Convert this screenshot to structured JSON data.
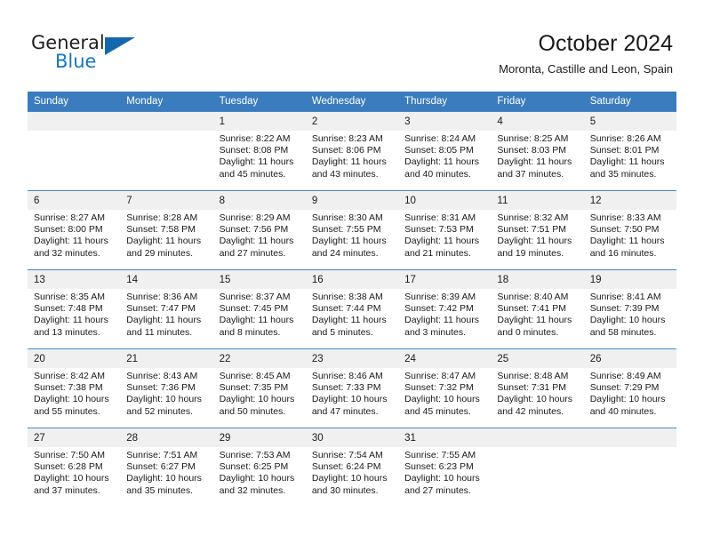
{
  "logo": {
    "word1": "General",
    "word2": "Blue",
    "triangle_color": "#1567ad",
    "blue_color": "#1479bb"
  },
  "header": {
    "title": "October 2024",
    "subtitle": "Moronta, Castille and Leon, Spain"
  },
  "theme": {
    "header_blue": "#3a7cbd",
    "grid_line": "#4a86c5",
    "daynum_bg": "#f0f0f0"
  },
  "weekdays": [
    "Sunday",
    "Monday",
    "Tuesday",
    "Wednesday",
    "Thursday",
    "Friday",
    "Saturday"
  ],
  "weeks": [
    [
      {
        "day": "",
        "lines": []
      },
      {
        "day": "",
        "lines": []
      },
      {
        "day": "1",
        "lines": [
          "Sunrise: 8:22 AM",
          "Sunset: 8:08 PM",
          "Daylight: 11 hours",
          "and 45 minutes."
        ]
      },
      {
        "day": "2",
        "lines": [
          "Sunrise: 8:23 AM",
          "Sunset: 8:06 PM",
          "Daylight: 11 hours",
          "and 43 minutes."
        ]
      },
      {
        "day": "3",
        "lines": [
          "Sunrise: 8:24 AM",
          "Sunset: 8:05 PM",
          "Daylight: 11 hours",
          "and 40 minutes."
        ]
      },
      {
        "day": "4",
        "lines": [
          "Sunrise: 8:25 AM",
          "Sunset: 8:03 PM",
          "Daylight: 11 hours",
          "and 37 minutes."
        ]
      },
      {
        "day": "5",
        "lines": [
          "Sunrise: 8:26 AM",
          "Sunset: 8:01 PM",
          "Daylight: 11 hours",
          "and 35 minutes."
        ]
      }
    ],
    [
      {
        "day": "6",
        "lines": [
          "Sunrise: 8:27 AM",
          "Sunset: 8:00 PM",
          "Daylight: 11 hours",
          "and 32 minutes."
        ]
      },
      {
        "day": "7",
        "lines": [
          "Sunrise: 8:28 AM",
          "Sunset: 7:58 PM",
          "Daylight: 11 hours",
          "and 29 minutes."
        ]
      },
      {
        "day": "8",
        "lines": [
          "Sunrise: 8:29 AM",
          "Sunset: 7:56 PM",
          "Daylight: 11 hours",
          "and 27 minutes."
        ]
      },
      {
        "day": "9",
        "lines": [
          "Sunrise: 8:30 AM",
          "Sunset: 7:55 PM",
          "Daylight: 11 hours",
          "and 24 minutes."
        ]
      },
      {
        "day": "10",
        "lines": [
          "Sunrise: 8:31 AM",
          "Sunset: 7:53 PM",
          "Daylight: 11 hours",
          "and 21 minutes."
        ]
      },
      {
        "day": "11",
        "lines": [
          "Sunrise: 8:32 AM",
          "Sunset: 7:51 PM",
          "Daylight: 11 hours",
          "and 19 minutes."
        ]
      },
      {
        "day": "12",
        "lines": [
          "Sunrise: 8:33 AM",
          "Sunset: 7:50 PM",
          "Daylight: 11 hours",
          "and 16 minutes."
        ]
      }
    ],
    [
      {
        "day": "13",
        "lines": [
          "Sunrise: 8:35 AM",
          "Sunset: 7:48 PM",
          "Daylight: 11 hours",
          "and 13 minutes."
        ]
      },
      {
        "day": "14",
        "lines": [
          "Sunrise: 8:36 AM",
          "Sunset: 7:47 PM",
          "Daylight: 11 hours",
          "and 11 minutes."
        ]
      },
      {
        "day": "15",
        "lines": [
          "Sunrise: 8:37 AM",
          "Sunset: 7:45 PM",
          "Daylight: 11 hours",
          "and 8 minutes."
        ]
      },
      {
        "day": "16",
        "lines": [
          "Sunrise: 8:38 AM",
          "Sunset: 7:44 PM",
          "Daylight: 11 hours",
          "and 5 minutes."
        ]
      },
      {
        "day": "17",
        "lines": [
          "Sunrise: 8:39 AM",
          "Sunset: 7:42 PM",
          "Daylight: 11 hours",
          "and 3 minutes."
        ]
      },
      {
        "day": "18",
        "lines": [
          "Sunrise: 8:40 AM",
          "Sunset: 7:41 PM",
          "Daylight: 11 hours",
          "and 0 minutes."
        ]
      },
      {
        "day": "19",
        "lines": [
          "Sunrise: 8:41 AM",
          "Sunset: 7:39 PM",
          "Daylight: 10 hours",
          "and 58 minutes."
        ]
      }
    ],
    [
      {
        "day": "20",
        "lines": [
          "Sunrise: 8:42 AM",
          "Sunset: 7:38 PM",
          "Daylight: 10 hours",
          "and 55 minutes."
        ]
      },
      {
        "day": "21",
        "lines": [
          "Sunrise: 8:43 AM",
          "Sunset: 7:36 PM",
          "Daylight: 10 hours",
          "and 52 minutes."
        ]
      },
      {
        "day": "22",
        "lines": [
          "Sunrise: 8:45 AM",
          "Sunset: 7:35 PM",
          "Daylight: 10 hours",
          "and 50 minutes."
        ]
      },
      {
        "day": "23",
        "lines": [
          "Sunrise: 8:46 AM",
          "Sunset: 7:33 PM",
          "Daylight: 10 hours",
          "and 47 minutes."
        ]
      },
      {
        "day": "24",
        "lines": [
          "Sunrise: 8:47 AM",
          "Sunset: 7:32 PM",
          "Daylight: 10 hours",
          "and 45 minutes."
        ]
      },
      {
        "day": "25",
        "lines": [
          "Sunrise: 8:48 AM",
          "Sunset: 7:31 PM",
          "Daylight: 10 hours",
          "and 42 minutes."
        ]
      },
      {
        "day": "26",
        "lines": [
          "Sunrise: 8:49 AM",
          "Sunset: 7:29 PM",
          "Daylight: 10 hours",
          "and 40 minutes."
        ]
      }
    ],
    [
      {
        "day": "27",
        "lines": [
          "Sunrise: 7:50 AM",
          "Sunset: 6:28 PM",
          "Daylight: 10 hours",
          "and 37 minutes."
        ]
      },
      {
        "day": "28",
        "lines": [
          "Sunrise: 7:51 AM",
          "Sunset: 6:27 PM",
          "Daylight: 10 hours",
          "and 35 minutes."
        ]
      },
      {
        "day": "29",
        "lines": [
          "Sunrise: 7:53 AM",
          "Sunset: 6:25 PM",
          "Daylight: 10 hours",
          "and 32 minutes."
        ]
      },
      {
        "day": "30",
        "lines": [
          "Sunrise: 7:54 AM",
          "Sunset: 6:24 PM",
          "Daylight: 10 hours",
          "and 30 minutes."
        ]
      },
      {
        "day": "31",
        "lines": [
          "Sunrise: 7:55 AM",
          "Sunset: 6:23 PM",
          "Daylight: 10 hours",
          "and 27 minutes."
        ]
      },
      {
        "day": "",
        "lines": []
      },
      {
        "day": "",
        "lines": []
      }
    ]
  ]
}
